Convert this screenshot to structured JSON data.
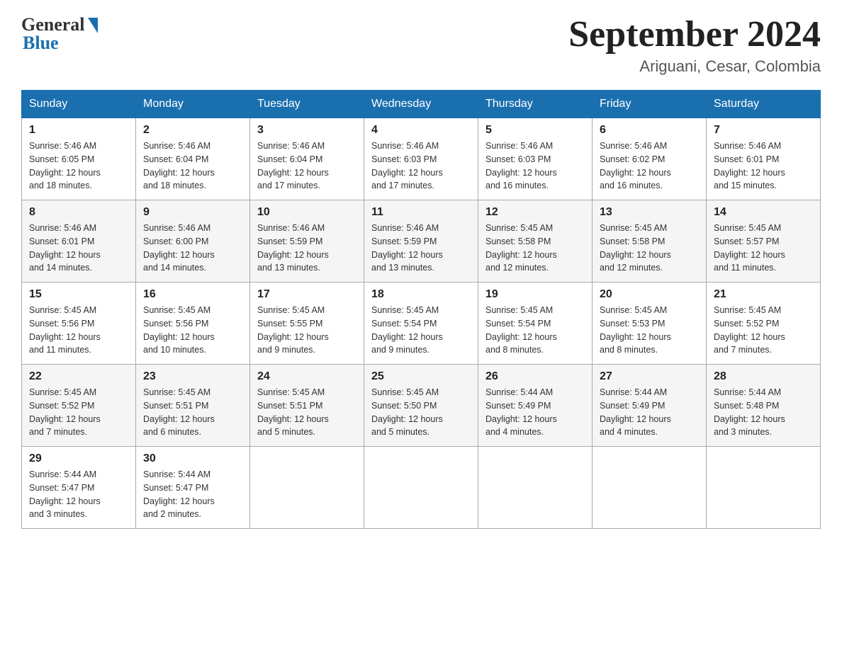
{
  "header": {
    "logo_general": "General",
    "logo_blue": "Blue",
    "month_title": "September 2024",
    "location": "Ariguani, Cesar, Colombia"
  },
  "days_of_week": [
    "Sunday",
    "Monday",
    "Tuesday",
    "Wednesday",
    "Thursday",
    "Friday",
    "Saturday"
  ],
  "weeks": [
    [
      {
        "day": "1",
        "sunrise": "5:46 AM",
        "sunset": "6:05 PM",
        "daylight": "12 hours and 18 minutes."
      },
      {
        "day": "2",
        "sunrise": "5:46 AM",
        "sunset": "6:04 PM",
        "daylight": "12 hours and 18 minutes."
      },
      {
        "day": "3",
        "sunrise": "5:46 AM",
        "sunset": "6:04 PM",
        "daylight": "12 hours and 17 minutes."
      },
      {
        "day": "4",
        "sunrise": "5:46 AM",
        "sunset": "6:03 PM",
        "daylight": "12 hours and 17 minutes."
      },
      {
        "day": "5",
        "sunrise": "5:46 AM",
        "sunset": "6:03 PM",
        "daylight": "12 hours and 16 minutes."
      },
      {
        "day": "6",
        "sunrise": "5:46 AM",
        "sunset": "6:02 PM",
        "daylight": "12 hours and 16 minutes."
      },
      {
        "day": "7",
        "sunrise": "5:46 AM",
        "sunset": "6:01 PM",
        "daylight": "12 hours and 15 minutes."
      }
    ],
    [
      {
        "day": "8",
        "sunrise": "5:46 AM",
        "sunset": "6:01 PM",
        "daylight": "12 hours and 14 minutes."
      },
      {
        "day": "9",
        "sunrise": "5:46 AM",
        "sunset": "6:00 PM",
        "daylight": "12 hours and 14 minutes."
      },
      {
        "day": "10",
        "sunrise": "5:46 AM",
        "sunset": "5:59 PM",
        "daylight": "12 hours and 13 minutes."
      },
      {
        "day": "11",
        "sunrise": "5:46 AM",
        "sunset": "5:59 PM",
        "daylight": "12 hours and 13 minutes."
      },
      {
        "day": "12",
        "sunrise": "5:45 AM",
        "sunset": "5:58 PM",
        "daylight": "12 hours and 12 minutes."
      },
      {
        "day": "13",
        "sunrise": "5:45 AM",
        "sunset": "5:58 PM",
        "daylight": "12 hours and 12 minutes."
      },
      {
        "day": "14",
        "sunrise": "5:45 AM",
        "sunset": "5:57 PM",
        "daylight": "12 hours and 11 minutes."
      }
    ],
    [
      {
        "day": "15",
        "sunrise": "5:45 AM",
        "sunset": "5:56 PM",
        "daylight": "12 hours and 11 minutes."
      },
      {
        "day": "16",
        "sunrise": "5:45 AM",
        "sunset": "5:56 PM",
        "daylight": "12 hours and 10 minutes."
      },
      {
        "day": "17",
        "sunrise": "5:45 AM",
        "sunset": "5:55 PM",
        "daylight": "12 hours and 9 minutes."
      },
      {
        "day": "18",
        "sunrise": "5:45 AM",
        "sunset": "5:54 PM",
        "daylight": "12 hours and 9 minutes."
      },
      {
        "day": "19",
        "sunrise": "5:45 AM",
        "sunset": "5:54 PM",
        "daylight": "12 hours and 8 minutes."
      },
      {
        "day": "20",
        "sunrise": "5:45 AM",
        "sunset": "5:53 PM",
        "daylight": "12 hours and 8 minutes."
      },
      {
        "day": "21",
        "sunrise": "5:45 AM",
        "sunset": "5:52 PM",
        "daylight": "12 hours and 7 minutes."
      }
    ],
    [
      {
        "day": "22",
        "sunrise": "5:45 AM",
        "sunset": "5:52 PM",
        "daylight": "12 hours and 7 minutes."
      },
      {
        "day": "23",
        "sunrise": "5:45 AM",
        "sunset": "5:51 PM",
        "daylight": "12 hours and 6 minutes."
      },
      {
        "day": "24",
        "sunrise": "5:45 AM",
        "sunset": "5:51 PM",
        "daylight": "12 hours and 5 minutes."
      },
      {
        "day": "25",
        "sunrise": "5:45 AM",
        "sunset": "5:50 PM",
        "daylight": "12 hours and 5 minutes."
      },
      {
        "day": "26",
        "sunrise": "5:44 AM",
        "sunset": "5:49 PM",
        "daylight": "12 hours and 4 minutes."
      },
      {
        "day": "27",
        "sunrise": "5:44 AM",
        "sunset": "5:49 PM",
        "daylight": "12 hours and 4 minutes."
      },
      {
        "day": "28",
        "sunrise": "5:44 AM",
        "sunset": "5:48 PM",
        "daylight": "12 hours and 3 minutes."
      }
    ],
    [
      {
        "day": "29",
        "sunrise": "5:44 AM",
        "sunset": "5:47 PM",
        "daylight": "12 hours and 3 minutes."
      },
      {
        "day": "30",
        "sunrise": "5:44 AM",
        "sunset": "5:47 PM",
        "daylight": "12 hours and 2 minutes."
      },
      null,
      null,
      null,
      null,
      null
    ]
  ],
  "labels": {
    "sunrise": "Sunrise:",
    "sunset": "Sunset:",
    "daylight": "Daylight:"
  }
}
